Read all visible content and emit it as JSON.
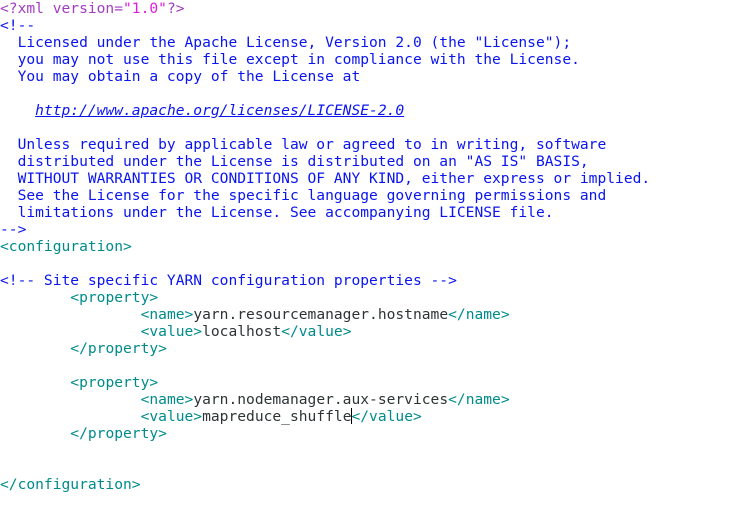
{
  "editor": {
    "lines": [
      [
        [
          "pi",
          "<?xml version="
        ],
        [
          "str",
          "\"1.0\""
        ],
        [
          "pi",
          "?>"
        ]
      ],
      [
        [
          "cm",
          "<!--"
        ]
      ],
      [
        [
          "cm",
          "  Licensed under the Apache License, Version 2.0 (the \"License\");"
        ]
      ],
      [
        [
          "cm",
          "  you may not use this file except in compliance with the License."
        ]
      ],
      [
        [
          "cm",
          "  You may obtain a copy of the License at"
        ]
      ],
      [],
      [
        [
          "cm",
          "    "
        ],
        [
          "link",
          "http://www.apache.org/licenses/LICENSE-2.0"
        ]
      ],
      [],
      [
        [
          "cm",
          "  Unless required by applicable law or agreed to in writing, software"
        ]
      ],
      [
        [
          "cm",
          "  distributed under the License is distributed on an \"AS IS\" BASIS,"
        ]
      ],
      [
        [
          "cm",
          "  WITHOUT WARRANTIES OR CONDITIONS OF ANY KIND, either express or implied."
        ]
      ],
      [
        [
          "cm",
          "  See the License for the specific language governing permissions and"
        ]
      ],
      [
        [
          "cm",
          "  limitations under the License. See accompanying LICENSE file."
        ]
      ],
      [
        [
          "cm",
          "-->"
        ]
      ],
      [
        [
          "tag",
          "<configuration>"
        ]
      ],
      [],
      [
        [
          "cm",
          "<!-- Site specific YARN configuration properties -->"
        ]
      ],
      [
        [
          "txt",
          "        "
        ],
        [
          "tag",
          "<property>"
        ]
      ],
      [
        [
          "txt",
          "                "
        ],
        [
          "tag",
          "<name>"
        ],
        [
          "txt",
          "yarn.resourcemanager.hostname"
        ],
        [
          "tag",
          "</name>"
        ]
      ],
      [
        [
          "txt",
          "                "
        ],
        [
          "tag",
          "<value>"
        ],
        [
          "txt",
          "localhost"
        ],
        [
          "tag",
          "</value>"
        ]
      ],
      [
        [
          "txt",
          "        "
        ],
        [
          "tag",
          "</property>"
        ]
      ],
      [],
      [
        [
          "txt",
          "        "
        ],
        [
          "tag",
          "<property>"
        ]
      ],
      [
        [
          "txt",
          "                "
        ],
        [
          "tag",
          "<name>"
        ],
        [
          "txt",
          "yarn.nodemanager.aux-services"
        ],
        [
          "tag",
          "</name>"
        ]
      ],
      [
        [
          "txt",
          "                "
        ],
        [
          "tag",
          "<value>"
        ],
        [
          "txt",
          "mapreduce_shuffle"
        ],
        [
          "caret",
          ""
        ],
        [
          "tag",
          "</value>"
        ]
      ],
      [
        [
          "txt",
          "        "
        ],
        [
          "tag",
          "</property>"
        ]
      ],
      [],
      [],
      [
        [
          "tag",
          "</configuration>"
        ]
      ]
    ]
  },
  "colors": {
    "processing_instruction": "#a23cc4",
    "string": "#e01cdc",
    "comment": "#0a14f0",
    "tag": "#008b8b",
    "text": "#2e3436"
  }
}
